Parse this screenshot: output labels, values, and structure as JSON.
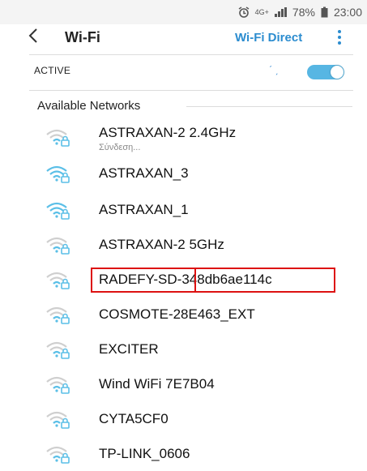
{
  "status_bar": {
    "network_type": "4G+",
    "battery": "78%",
    "time": "23:00"
  },
  "app_bar": {
    "back_icon": "back-arrow-icon",
    "title": "Wi-Fi",
    "direct_label": "Wi-Fi Direct",
    "more_icon": "more-vert-icon"
  },
  "wifi_toggle": {
    "label": "ACTIVE",
    "state": "on",
    "color": "#57b6e3"
  },
  "networks_section": {
    "title": "Available  Networks",
    "items": [
      {
        "name": "ASTRAXAN-2  2.4GHz",
        "status": "Σύνδεση...",
        "signal": "weak",
        "secured": true
      },
      {
        "name": "ASTRAXAN_3",
        "status": "",
        "signal": "strong",
        "secured": true
      },
      {
        "name": "ASTRAXAN_1",
        "status": "",
        "signal": "strong",
        "secured": true
      },
      {
        "name": "ASTRAXAN-2  5GHz",
        "status": "",
        "signal": "weak",
        "secured": true
      },
      {
        "name": "RADEFY-SD-348db6ae114c",
        "status": "",
        "signal": "weak",
        "secured": true
      },
      {
        "name": "COSMOTE-28E463_EXT",
        "status": "",
        "signal": "weak",
        "secured": true
      },
      {
        "name": "EXCITER",
        "status": "",
        "signal": "weak",
        "secured": true
      },
      {
        "name": "Wind WiFi 7E7B04",
        "status": "",
        "signal": "weak",
        "secured": true
      },
      {
        "name": "CYTA5CF0",
        "status": "",
        "signal": "weak",
        "secured": true
      },
      {
        "name": "TP-LINK_0606",
        "status": "",
        "signal": "weak",
        "secured": true
      }
    ]
  },
  "highlight_color": "#d11"
}
